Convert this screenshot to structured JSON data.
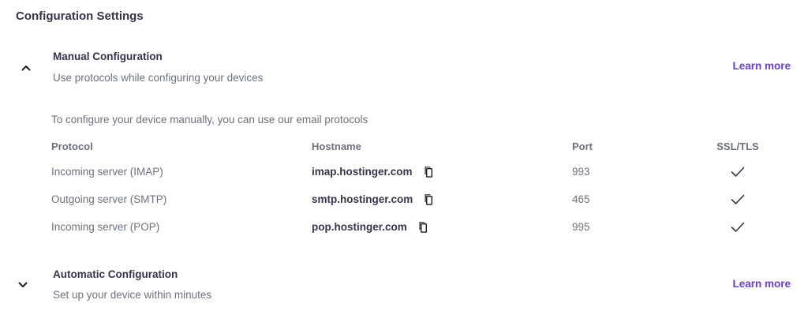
{
  "page": {
    "title": "Configuration Settings"
  },
  "manual": {
    "title": "Manual Configuration",
    "subtitle": "Use protocols while configuring your devices",
    "learn_more": "Learn more",
    "expanded": true,
    "intro": "To configure your device manually, you can use our email protocols",
    "columns": {
      "protocol": "Protocol",
      "hostname": "Hostname",
      "port": "Port",
      "ssl": "SSL/TLS"
    },
    "rows": [
      {
        "protocol": "Incoming server (IMAP)",
        "hostname": "imap.hostinger.com",
        "port": "993",
        "ssl": true
      },
      {
        "protocol": "Outgoing server (SMTP)",
        "hostname": "smtp.hostinger.com",
        "port": "465",
        "ssl": true
      },
      {
        "protocol": "Incoming server (POP)",
        "hostname": "pop.hostinger.com",
        "port": "995",
        "ssl": true
      }
    ]
  },
  "automatic": {
    "title": "Automatic Configuration",
    "subtitle": "Set up your device within minutes",
    "learn_more": "Learn more",
    "expanded": false
  },
  "icons": {
    "manual_toggle": "chevron-up-icon",
    "automatic_toggle": "chevron-down-icon",
    "copy": "copy-icon",
    "ssl": "check-icon"
  },
  "colors": {
    "accent": "#673de6",
    "text_dark": "#36344d",
    "text_muted": "#6d7081"
  }
}
